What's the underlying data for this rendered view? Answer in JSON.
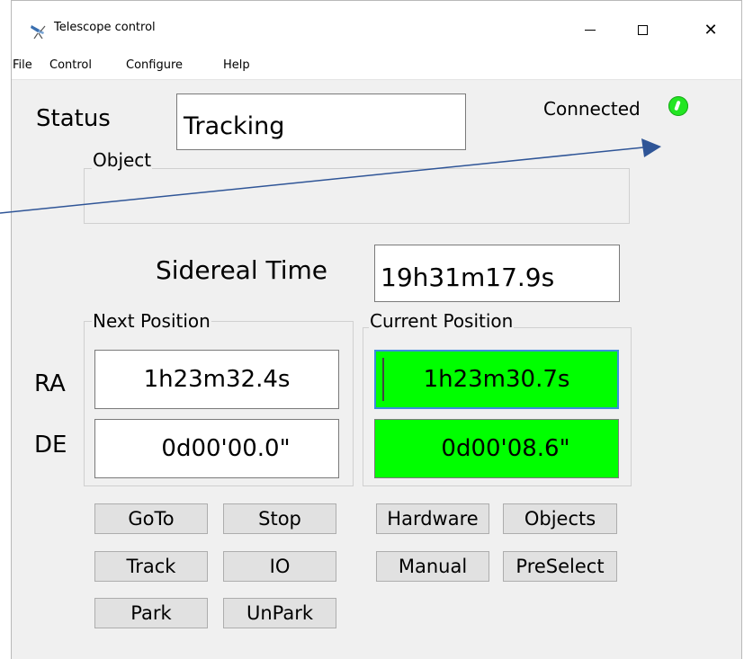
{
  "window": {
    "title": "Telescope control",
    "controls": {
      "minimize_icon": "minimize-icon",
      "maximize_icon": "maximize-icon",
      "close_icon": "close-icon",
      "close_glyph": "✕"
    }
  },
  "menu": [
    "File",
    "Control",
    "Configure",
    "Help"
  ],
  "status": {
    "label": "Status",
    "value": "Tracking"
  },
  "connection": {
    "label": "Connected",
    "indicator_color": "#22e622"
  },
  "object_group": {
    "title": "Object"
  },
  "sidereal": {
    "label": "Sidereal Time",
    "value": "19h31m17.9s"
  },
  "next_position": {
    "title": "Next Position",
    "ra": "1h23m32.4s",
    "de": "0d00'00.0\""
  },
  "current_position": {
    "title": "Current Position",
    "ra": "1h23m30.7s",
    "de": "0d00'08.6\"",
    "highlight_color": "#00ff00"
  },
  "axis_labels": {
    "ra": "RA",
    "de": "DE"
  },
  "buttons": {
    "goto": "GoTo",
    "stop": "Stop",
    "track": "Track",
    "io": "IO",
    "park": "Park",
    "unpark": "UnPark",
    "hardware": "Hardware",
    "objects": "Objects",
    "manual": "Manual",
    "preselect": "PreSelect"
  },
  "annotation": {
    "arrow_color": "#2f5597"
  }
}
